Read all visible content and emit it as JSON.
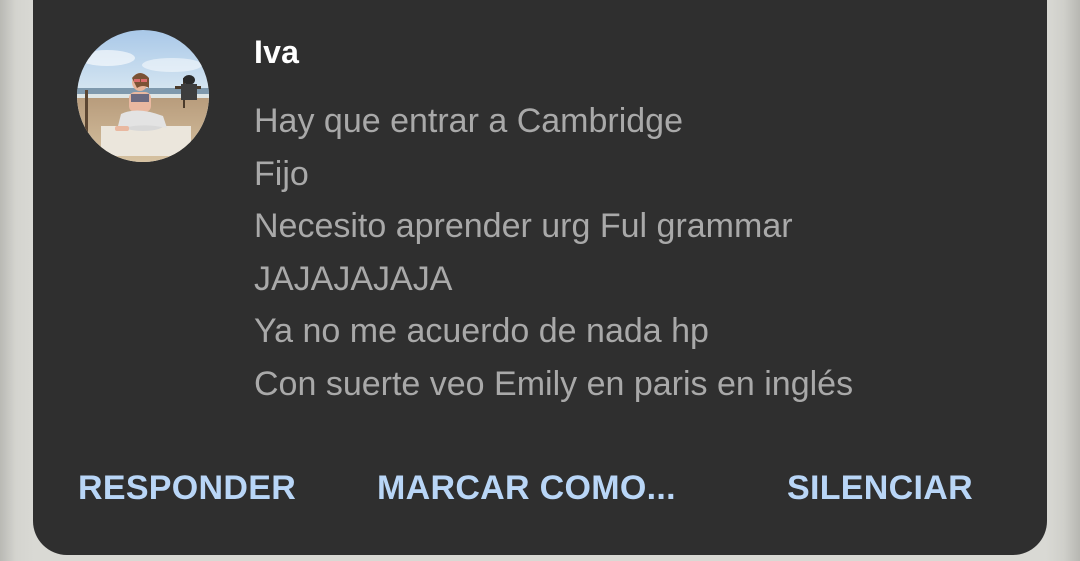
{
  "notification": {
    "sender": "Iva",
    "messages": [
      "Hay que entrar a Cambridge",
      "Fijo",
      "Necesito aprender urg Ful grammar",
      "JAJAJAJAJA",
      "Ya no me acuerdo de nada hp",
      "Con suerte veo Emily en paris en inglés"
    ],
    "actions": {
      "reply": "RESPONDER",
      "mark": "MARCAR COMO...",
      "mute": "SILENCIAR"
    }
  },
  "colors": {
    "card_background": "#2f2f2f",
    "sender_text": "#ffffff",
    "message_text": "#a9a9a9",
    "action_text": "#b9d6f7",
    "outer_background": "#d9d9d4"
  },
  "icons": {
    "avatar": "contact-photo-beach"
  }
}
